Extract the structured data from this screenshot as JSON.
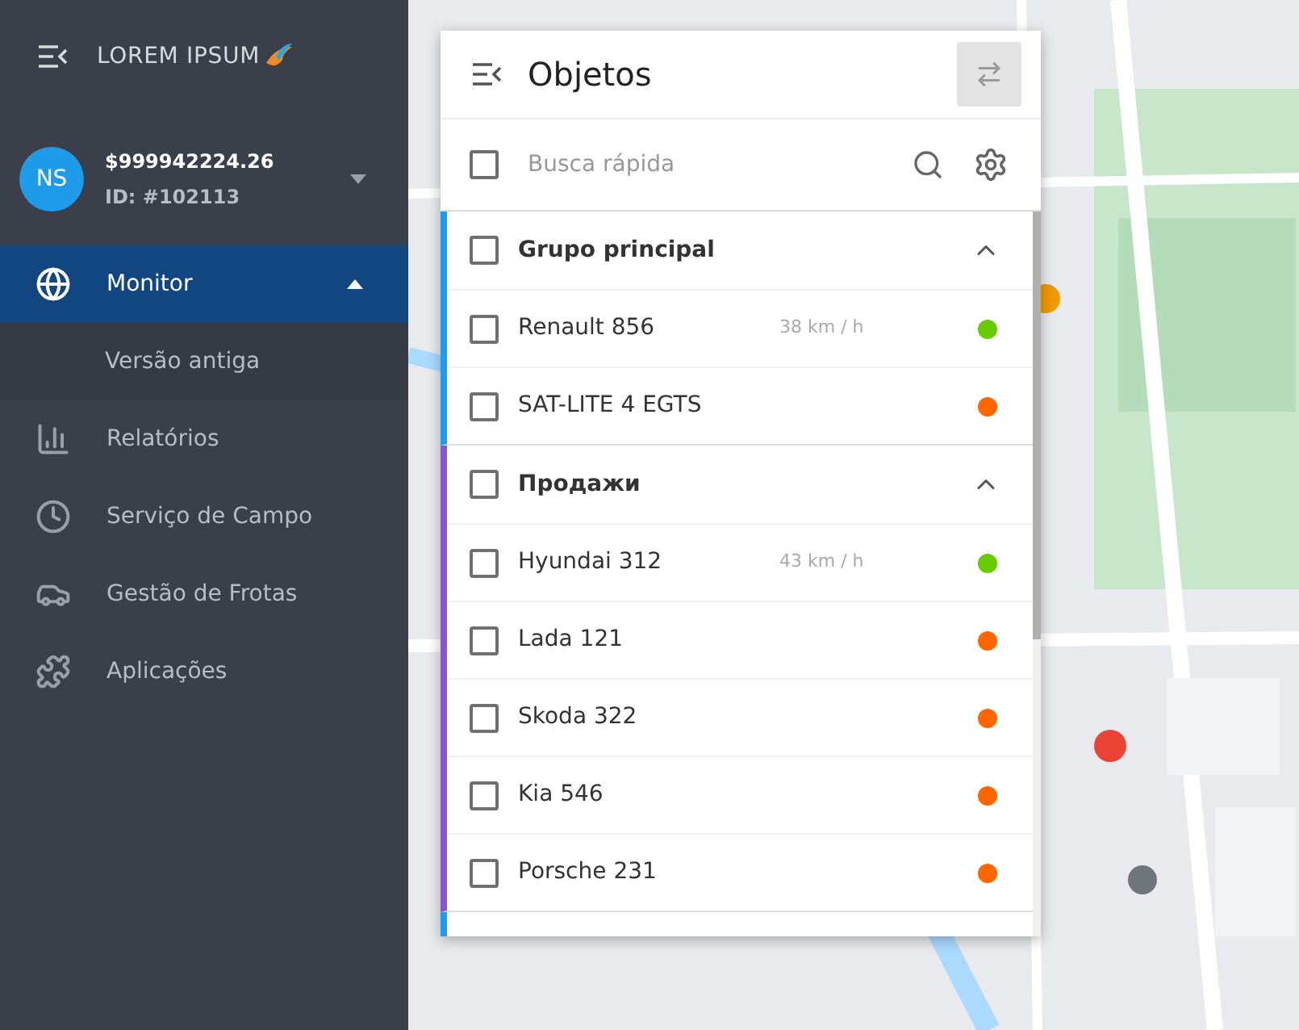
{
  "brand": {
    "name": "LOREM IPSUM"
  },
  "account": {
    "initials": "NS",
    "balance": "$999942224.26",
    "id": "ID: #102113",
    "expanded": false
  },
  "nav": [
    {
      "label": "Monitor",
      "selected": true,
      "expanded": true,
      "children": [
        {
          "label": "Versão antiga"
        }
      ]
    },
    {
      "label": "Relatórios",
      "selected": false
    },
    {
      "label": "Serviço de Campo",
      "selected": false
    },
    {
      "label": "Gestão de Frotas",
      "selected": false
    },
    {
      "label": "Aplicações",
      "selected": false
    }
  ],
  "panel": {
    "title": "Objetos",
    "search": {
      "placeholder": "Busca rápida",
      "checked": false
    },
    "groups": [
      {
        "name": "Grupo principal",
        "color": "#1e9be9",
        "expanded": true,
        "checked": false,
        "items": [
          {
            "name": "Renault 856",
            "speed": "38 km / h",
            "color": "#66cc00",
            "checked": false
          },
          {
            "name": "SAT-LITE 4 EGTS",
            "color": "#ff6600",
            "checked": false
          }
        ]
      },
      {
        "name": "Продажи",
        "color": "#8855cc",
        "expanded": true,
        "checked": false,
        "items": [
          {
            "name": "Hyundai 312",
            "speed": "43 km / h",
            "color": "#66cc00",
            "checked": false
          },
          {
            "name": "Lada 121",
            "color": "#ff6600",
            "checked": false
          },
          {
            "name": "Skoda 322",
            "color": "#ff6600",
            "checked": false
          },
          {
            "name": "Kia 546",
            "color": "#ff6600",
            "checked": false
          },
          {
            "name": "Porsche 231",
            "color": "#ff6600",
            "checked": false
          }
        ]
      }
    ]
  }
}
